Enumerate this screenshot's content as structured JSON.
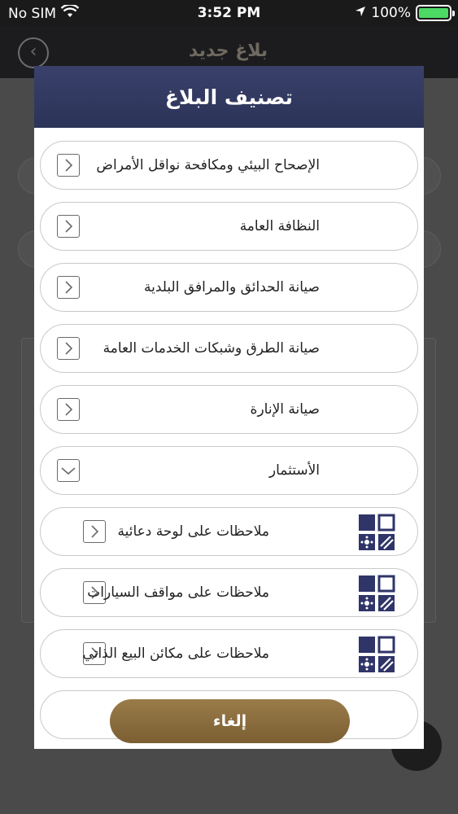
{
  "status_bar": {
    "carrier": "No SIM",
    "time": "3:52 PM",
    "battery": "100%",
    "battery_level": 1.0
  },
  "background_screen": {
    "title": "بلاغ جديد"
  },
  "modal": {
    "title": "تصنيف البلاغ",
    "categories": [
      {
        "label": "الإصحاح البيئي ومكافحة نواقل الأمراض",
        "expanded": false
      },
      {
        "label": "النظافة العامة",
        "expanded": false
      },
      {
        "label": "صيانة الحدائق والمرافق البلدية",
        "expanded": false
      },
      {
        "label": "صيانة الطرق وشبكات الخدمات العامة",
        "expanded": false
      },
      {
        "label": "صيانة الإنارة",
        "expanded": false
      },
      {
        "label": "الأستثمار",
        "expanded": true
      }
    ],
    "subcategories": [
      {
        "label": "ملاحظات على لوحة دعائية"
      },
      {
        "label": "ملاحظات على مواقف السيارات"
      },
      {
        "label": "ملاحظات على مكائن البيع الذاتي"
      }
    ],
    "cancel_label": "إلغاء"
  },
  "colors": {
    "header": "#2f3660",
    "accent_gold": "#8a6d3b",
    "icon_navy": "#2f3568"
  }
}
